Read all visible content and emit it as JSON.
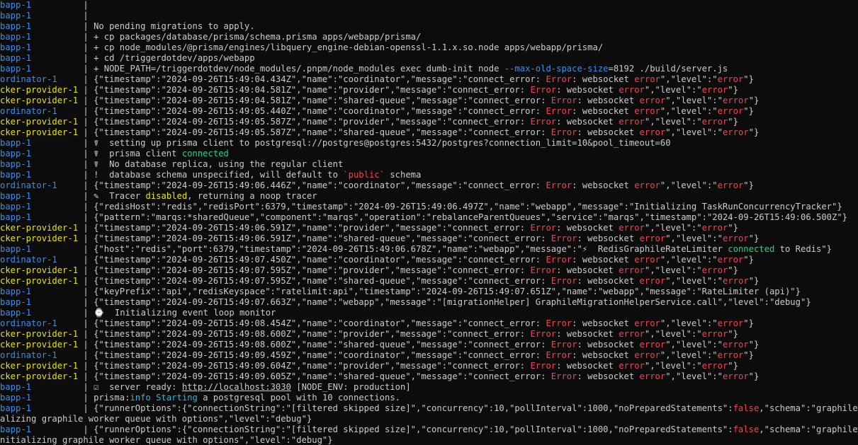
{
  "terminal": {
    "colors": {
      "background": "#0c0c0c",
      "foreground": "#cccccc",
      "webapp": "#3b8eea",
      "coordinator": "#3b8eea",
      "provider": "#e5e510",
      "error": "#e74856",
      "success": "#23d18b",
      "info": "#29b8db"
    },
    "lines": [
      [
        {
          "t": "bapp-1          ",
          "c": "blue"
        },
        {
          "t": "|"
        }
      ],
      [
        {
          "t": "bapp-1          ",
          "c": "blue"
        },
        {
          "t": "|"
        }
      ],
      [
        {
          "t": "bapp-1          ",
          "c": "blue"
        },
        {
          "t": "| No pending migrations to apply."
        }
      ],
      [
        {
          "t": "bapp-1          ",
          "c": "blue"
        },
        {
          "t": "| + cp packages/database/prisma/schema.prisma apps/webapp/prisma/"
        }
      ],
      [
        {
          "t": "bapp-1          ",
          "c": "blue"
        },
        {
          "t": "| + cp node_modules/@prisma/engines/libquery_engine-debian-openssl-1.1.x.so.node apps/webapp/prisma/"
        }
      ],
      [
        {
          "t": "bapp-1          ",
          "c": "blue"
        },
        {
          "t": "| + cd /triggerdotdev/apps/webapp"
        }
      ],
      [
        {
          "t": "bapp-1          ",
          "c": "blue"
        },
        {
          "t": "| + NODE_PATH=/triggerdotdev/node_modules/.pnpm/node_modules exec dumb-init node "
        },
        {
          "t": "--max-old-space-size",
          "c": "blue"
        },
        {
          "t": "=8192 ./build/server.js"
        }
      ],
      [
        {
          "t": "ordinator-1     ",
          "c": "blue"
        },
        {
          "t": "| {\"timestamp\":\"2024-09-26T15:49:04.434Z\",\"name\":\"coordinator\",\"message\":\"connect_error: "
        },
        {
          "t": "Error",
          "c": "red"
        },
        {
          "t": ": websocket "
        },
        {
          "t": "error",
          "c": "red"
        },
        {
          "t": "\",\"level\":\""
        },
        {
          "t": "error",
          "c": "red"
        },
        {
          "t": "\"}"
        }
      ],
      [
        {
          "t": "cker-provider-1 ",
          "c": "yellow"
        },
        {
          "t": "| {\"timestamp\":\"2024-09-26T15:49:04.581Z\",\"name\":\"provider\",\"message\":\"connect_error: "
        },
        {
          "t": "Error",
          "c": "red"
        },
        {
          "t": ": websocket "
        },
        {
          "t": "error",
          "c": "red"
        },
        {
          "t": "\",\"level\":\""
        },
        {
          "t": "error",
          "c": "red"
        },
        {
          "t": "\"}"
        }
      ],
      [
        {
          "t": "cker-provider-1 ",
          "c": "yellow"
        },
        {
          "t": "| {\"timestamp\":\"2024-09-26T15:49:04.581Z\",\"name\":\"shared-queue\",\"message\":\"connect_error: "
        },
        {
          "t": "Error",
          "c": "red"
        },
        {
          "t": ": websocket "
        },
        {
          "t": "error",
          "c": "red"
        },
        {
          "t": "\",\"level\":\""
        },
        {
          "t": "error",
          "c": "red"
        },
        {
          "t": "\"}"
        }
      ],
      [
        {
          "t": "ordinator-1     ",
          "c": "blue"
        },
        {
          "t": "| {\"timestamp\":\"2024-09-26T15:49:05.440Z\",\"name\":\"coordinator\",\"message\":\"connect_error: "
        },
        {
          "t": "Error",
          "c": "red"
        },
        {
          "t": ": websocket "
        },
        {
          "t": "error",
          "c": "red"
        },
        {
          "t": "\",\"level\":\""
        },
        {
          "t": "error",
          "c": "red"
        },
        {
          "t": "\"}"
        }
      ],
      [
        {
          "t": "cker-provider-1 ",
          "c": "yellow"
        },
        {
          "t": "| {\"timestamp\":\"2024-09-26T15:49:05.587Z\",\"name\":\"provider\",\"message\":\"connect_error: "
        },
        {
          "t": "Error",
          "c": "red"
        },
        {
          "t": ": websocket "
        },
        {
          "t": "error",
          "c": "red"
        },
        {
          "t": "\",\"level\":\""
        },
        {
          "t": "error",
          "c": "red"
        },
        {
          "t": "\"}"
        }
      ],
      [
        {
          "t": "cker-provider-1 ",
          "c": "yellow"
        },
        {
          "t": "| {\"timestamp\":\"2024-09-26T15:49:05.587Z\",\"name\":\"shared-queue\",\"message\":\"connect_error: "
        },
        {
          "t": "Error",
          "c": "red"
        },
        {
          "t": ": websocket "
        },
        {
          "t": "error",
          "c": "red"
        },
        {
          "t": "\",\"level\":\""
        },
        {
          "t": "error",
          "c": "red"
        },
        {
          "t": "\"}"
        }
      ],
      [
        {
          "t": "bapp-1          ",
          "c": "blue"
        },
        {
          "t": "| ☤  setting up prisma client to postgresql://postgres@postgres:5432/postgres?connection_limit=10&pool_timeout=60"
        }
      ],
      [
        {
          "t": "bapp-1          ",
          "c": "blue"
        },
        {
          "t": "| ☤  prisma client "
        },
        {
          "t": "connected",
          "c": "green"
        }
      ],
      [
        {
          "t": "bapp-1          ",
          "c": "blue"
        },
        {
          "t": "| ☤  No database replica, using the regular client"
        }
      ],
      [
        {
          "t": "bapp-1          ",
          "c": "blue"
        },
        {
          "t": "| !  database schema unspecified, will default to "
        },
        {
          "t": "`public`",
          "c": "red"
        },
        {
          "t": " schema"
        }
      ],
      [
        {
          "t": "ordinator-1     ",
          "c": "blue"
        },
        {
          "t": "| {\"timestamp\":\"2024-09-26T15:49:06.446Z\",\"name\":\"coordinator\",\"message\":\"connect_error: "
        },
        {
          "t": "Error",
          "c": "red"
        },
        {
          "t": ": websocket "
        },
        {
          "t": "error",
          "c": "red"
        },
        {
          "t": "\",\"level\":\""
        },
        {
          "t": "error",
          "c": "red"
        },
        {
          "t": "\"}"
        }
      ],
      [
        {
          "t": "bapp-1          ",
          "c": "blue"
        },
        {
          "t": "| ✎  Tracer "
        },
        {
          "t": "disabled",
          "c": "yellow"
        },
        {
          "t": ", returning a noop tracer"
        }
      ],
      [
        {
          "t": "bapp-1          ",
          "c": "blue"
        },
        {
          "t": "| {\"redisHost\":\"redis\",\"redisPort\":6379,\"timestamp\":\"2024-09-26T15:49:06.497Z\",\"name\":\"webapp\",\"message\":\"Initializing TaskRunConcurrencyTracker\"}"
        }
      ],
      [
        {
          "t": "bapp-1          ",
          "c": "blue"
        },
        {
          "t": "| {\"pattern\":\"marqs:*sharedQueue\",\"component\":\"marqs\",\"operation\":\"rebalanceParentQueues\",\"service\":\"marqs\",\"timestamp\":\"2024-09-26T15:49:06.500Z\"}"
        }
      ],
      [
        {
          "t": "cker-provider-1 ",
          "c": "yellow"
        },
        {
          "t": "| {\"timestamp\":\"2024-09-26T15:49:06.591Z\",\"name\":\"provider\",\"message\":\"connect_error: "
        },
        {
          "t": "Error",
          "c": "red"
        },
        {
          "t": ": websocket "
        },
        {
          "t": "error",
          "c": "red"
        },
        {
          "t": "\",\"level\":\""
        },
        {
          "t": "error",
          "c": "red"
        },
        {
          "t": "\"}"
        }
      ],
      [
        {
          "t": "cker-provider-1 ",
          "c": "yellow"
        },
        {
          "t": "| {\"timestamp\":\"2024-09-26T15:49:06.591Z\",\"name\":\"shared-queue\",\"message\":\"connect_error: "
        },
        {
          "t": "Error",
          "c": "red"
        },
        {
          "t": ": websocket "
        },
        {
          "t": "error",
          "c": "red"
        },
        {
          "t": "\",\"level\":\""
        },
        {
          "t": "error",
          "c": "red"
        },
        {
          "t": "\"}"
        }
      ],
      [
        {
          "t": "bapp-1          ",
          "c": "blue"
        },
        {
          "t": "| {\"host\":\"redis\",\"port\":6379,\"timestamp\":\"2024-09-26T15:49:06.678Z\",\"name\":\"webapp\",\"message\":\"⚡  RedisGraphileRateLimiter "
        },
        {
          "t": "connected",
          "c": "green"
        },
        {
          "t": " to Redis\"}"
        }
      ],
      [
        {
          "t": "ordinator-1     ",
          "c": "blue"
        },
        {
          "t": "| {\"timestamp\":\"2024-09-26T15:49:07.450Z\",\"name\":\"coordinator\",\"message\":\"connect_error: "
        },
        {
          "t": "Error",
          "c": "red"
        },
        {
          "t": ": websocket "
        },
        {
          "t": "error",
          "c": "red"
        },
        {
          "t": "\",\"level\":\""
        },
        {
          "t": "error",
          "c": "red"
        },
        {
          "t": "\"}"
        }
      ],
      [
        {
          "t": "cker-provider-1 ",
          "c": "yellow"
        },
        {
          "t": "| {\"timestamp\":\"2024-09-26T15:49:07.595Z\",\"name\":\"provider\",\"message\":\"connect_error: "
        },
        {
          "t": "Error",
          "c": "red"
        },
        {
          "t": ": websocket "
        },
        {
          "t": "error",
          "c": "red"
        },
        {
          "t": "\",\"level\":\""
        },
        {
          "t": "error",
          "c": "red"
        },
        {
          "t": "\"}"
        }
      ],
      [
        {
          "t": "cker-provider-1 ",
          "c": "yellow"
        },
        {
          "t": "| {\"timestamp\":\"2024-09-26T15:49:07.595Z\",\"name\":\"shared-queue\",\"message\":\"connect_error: "
        },
        {
          "t": "Error",
          "c": "red"
        },
        {
          "t": ": websocket "
        },
        {
          "t": "error",
          "c": "red"
        },
        {
          "t": "\",\"level\":\""
        },
        {
          "t": "error",
          "c": "red"
        },
        {
          "t": "\"}"
        }
      ],
      [
        {
          "t": "bapp-1          ",
          "c": "blue"
        },
        {
          "t": "| {\"keyPrefix\":\"api\",\"redisKeyspace\":\"ratelimit:api\",\"timestamp\":\"2024-09-26T15:49:07.651Z\",\"name\":\"webapp\",\"message\":\"RateLimiter (api)\"}"
        }
      ],
      [
        {
          "t": "bapp-1          ",
          "c": "blue"
        },
        {
          "t": "| {\"timestamp\":\"2024-09-26T15:49:07.663Z\",\"name\":\"webapp\",\"message\":\"[migrationHelper] GraphileMigrationHelperService.call\",\"level\":\"debug\"}"
        }
      ],
      [
        {
          "t": "bapp-1          ",
          "c": "blue"
        },
        {
          "t": "| ⌚  Initializing event loop monitor"
        }
      ],
      [
        {
          "t": "ordinator-1     ",
          "c": "blue"
        },
        {
          "t": "| {\"timestamp\":\"2024-09-26T15:49:08.454Z\",\"name\":\"coordinator\",\"message\":\"connect_error: "
        },
        {
          "t": "Error",
          "c": "red"
        },
        {
          "t": ": websocket "
        },
        {
          "t": "error",
          "c": "red"
        },
        {
          "t": "\",\"level\":\""
        },
        {
          "t": "error",
          "c": "red"
        },
        {
          "t": "\"}"
        }
      ],
      [
        {
          "t": "cker-provider-1 ",
          "c": "yellow"
        },
        {
          "t": "| {\"timestamp\":\"2024-09-26T15:49:08.600Z\",\"name\":\"provider\",\"message\":\"connect_error: "
        },
        {
          "t": "Error",
          "c": "red"
        },
        {
          "t": ": websocket "
        },
        {
          "t": "error",
          "c": "red"
        },
        {
          "t": "\",\"level\":\""
        },
        {
          "t": "error",
          "c": "red"
        },
        {
          "t": "\"}"
        }
      ],
      [
        {
          "t": "cker-provider-1 ",
          "c": "yellow"
        },
        {
          "t": "| {\"timestamp\":\"2024-09-26T15:49:08.600Z\",\"name\":\"shared-queue\",\"message\":\"connect_error: "
        },
        {
          "t": "Error",
          "c": "red"
        },
        {
          "t": ": websocket "
        },
        {
          "t": "error",
          "c": "red"
        },
        {
          "t": "\",\"level\":\""
        },
        {
          "t": "error",
          "c": "red"
        },
        {
          "t": "\"}"
        }
      ],
      [
        {
          "t": "ordinator-1     ",
          "c": "blue"
        },
        {
          "t": "| {\"timestamp\":\"2024-09-26T15:49:09.459Z\",\"name\":\"coordinator\",\"message\":\"connect_error: "
        },
        {
          "t": "Error",
          "c": "red"
        },
        {
          "t": ": websocket "
        },
        {
          "t": "error",
          "c": "red"
        },
        {
          "t": "\",\"level\":\""
        },
        {
          "t": "error",
          "c": "red"
        },
        {
          "t": "\"}"
        }
      ],
      [
        {
          "t": "cker-provider-1 ",
          "c": "yellow"
        },
        {
          "t": "| {\"timestamp\":\"2024-09-26T15:49:09.604Z\",\"name\":\"provider\",\"message\":\"connect_error: "
        },
        {
          "t": "Error",
          "c": "red"
        },
        {
          "t": ": websocket "
        },
        {
          "t": "error",
          "c": "red"
        },
        {
          "t": "\",\"level\":\""
        },
        {
          "t": "error",
          "c": "red"
        },
        {
          "t": "\"}"
        }
      ],
      [
        {
          "t": "cker-provider-1 ",
          "c": "yellow"
        },
        {
          "t": "| {\"timestamp\":\"2024-09-26T15:49:09.605Z\",\"name\":\"shared-queue\",\"message\":\"connect_error: "
        },
        {
          "t": "Error",
          "c": "red"
        },
        {
          "t": ": websocket "
        },
        {
          "t": "error",
          "c": "red"
        },
        {
          "t": "\",\"level\":\""
        },
        {
          "t": "error",
          "c": "red"
        },
        {
          "t": "\"}"
        }
      ],
      [
        {
          "t": "bapp-1          ",
          "c": "blue"
        },
        {
          "t": "| ☑  server ready: "
        },
        {
          "t": "http://localhost:3030",
          "c": "link"
        },
        {
          "t": " [NODE_ENV: production]"
        }
      ],
      [
        {
          "t": "bapp-1          ",
          "c": "blue"
        },
        {
          "t": "| prisma:"
        },
        {
          "t": "info",
          "c": "cyan"
        },
        {
          "t": " "
        },
        {
          "t": "Starting",
          "c": "cyan"
        },
        {
          "t": " a postgresql pool with 10 connections."
        }
      ],
      [
        {
          "t": "bapp-1          ",
          "c": "blue"
        },
        {
          "t": "| {\"runnerOptions\":{\"connectionString\":\"[filtered skipped size]\",\"concurrency\":10,\"pollInterval\":1000,\"noPreparedStatements\":"
        },
        {
          "t": "false",
          "c": "red"
        },
        {
          "t": ",\"schema\":\"graphile_worker\"}"
        }
      ],
      [
        {
          "t": "alizing graphile worker queue with options\",\"level\":\"debug\"}"
        }
      ],
      [
        {
          "t": "bapp-1          ",
          "c": "blue"
        },
        {
          "t": "| {\"runnerOptions\":{\"connectionString\":\"[filtered skipped size]\",\"concurrency\":10,\"pollInterval\":1000,\"noPreparedStatements\":"
        },
        {
          "t": "false",
          "c": "red"
        },
        {
          "t": ",\"schema\":\"graphile_worker\"}"
        }
      ],
      [
        {
          "t": "nitializing graphile worker queue with options\",\"level\":\"debug\"}"
        }
      ]
    ]
  }
}
